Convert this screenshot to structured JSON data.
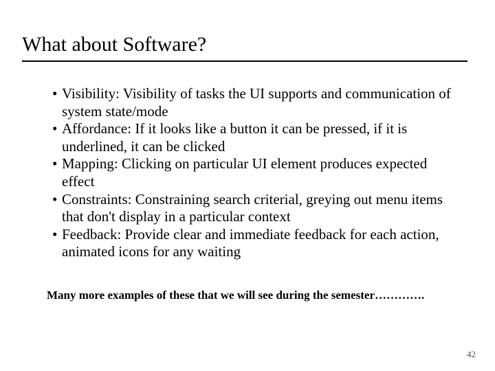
{
  "title": "What about Software?",
  "bullets": [
    "Visibility: Visibility of tasks the UI supports and communication of system state/mode",
    "Affordance: If it looks like a button it can be pressed, if it is underlined, it can be clicked",
    "Mapping: Clicking on particular UI element produces expected effect",
    "Constraints: Constraining search criterial, greying out menu items that don't display in a particular context",
    "Feedback: Provide clear and immediate feedback for each action, animated icons for any waiting"
  ],
  "footnote": "Many more examples of these that we will see during the semester………….",
  "page_number": "42"
}
